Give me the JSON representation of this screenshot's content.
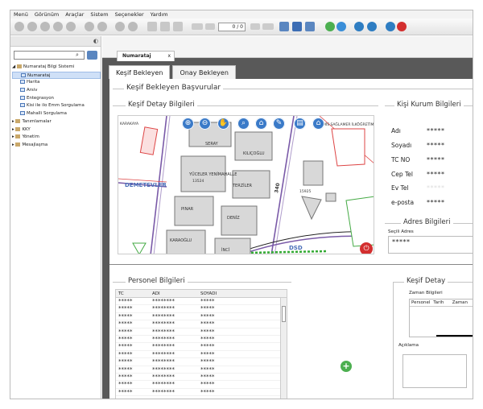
{
  "menu": [
    "Menü",
    "Görünüm",
    "Araçlar",
    "Sistem",
    "Seçenekler",
    "Yardım"
  ],
  "toolbar": {
    "page_value": "0 / 0"
  },
  "sidebar": {
    "tree": [
      {
        "label": "Numarataj Bilgi Sistemi",
        "level": 0,
        "type": "folder"
      },
      {
        "label": "Numarataj",
        "level": 1,
        "type": "page",
        "selected": true
      },
      {
        "label": "Harita",
        "level": 1,
        "type": "page"
      },
      {
        "label": "Arsiv",
        "level": 1,
        "type": "page"
      },
      {
        "label": "Entegrasyon",
        "level": 1,
        "type": "page"
      },
      {
        "label": "Kisi ile ilo Emm Sorgulama",
        "level": 1,
        "type": "page"
      },
      {
        "label": "Mahalli Sorgulama",
        "level": 1,
        "type": "page"
      },
      {
        "label": "Tanımlamalar",
        "level": 0,
        "type": "folder"
      },
      {
        "label": "KKY",
        "level": 0,
        "type": "folder"
      },
      {
        "label": "Yönetim",
        "level": 0,
        "type": "folder"
      },
      {
        "label": "Mesajlaşma",
        "level": 0,
        "type": "folder"
      }
    ]
  },
  "doc_tab": {
    "label": "Numarataj",
    "close": "x"
  },
  "tabs": [
    "Keşif Bekleyen",
    "Onay Bekleyen"
  ],
  "sections": {
    "basvurular": "Keşif Bekleyen Başvurular",
    "kesif_detay_bilgileri": "Keşif Detay Bilgileri",
    "kisi_kurum": "Kişi Kurum Bilgileri",
    "adres": "Adres Bilgileri",
    "personel": "Personel Bilgileri",
    "kesif_detay": "Keşif Detay"
  },
  "map": {
    "labels": [
      "SERAY",
      "KILIÇOĞLU",
      "YÜCELER YENİMAHALLE",
      "TERZİLER",
      "PINAR",
      "DENİZ",
      "KARAOĞLU",
      "İNCİ",
      "DEMETEVLER",
      "KARAKAYA",
      "MİS SAĞLAMER İLKÖĞRETİM",
      "DSD",
      "340",
      "15925",
      "13524"
    ]
  },
  "kisi": {
    "fields": [
      {
        "label": "Adı",
        "value": "*****"
      },
      {
        "label": "Soyadı",
        "value": "*****"
      },
      {
        "label": "TC NO",
        "value": "*****"
      },
      {
        "label": "Cep Tel",
        "value": "*****"
      },
      {
        "label": "Ev Tel",
        "value": "*****"
      },
      {
        "label": "e-posta",
        "value": "*****"
      }
    ]
  },
  "adres": {
    "label": "Seçili Adres",
    "value": "*****"
  },
  "personel": {
    "headers": [
      "TC",
      "ADI",
      "SOYADI",
      ""
    ],
    "rows": [
      [
        "*****",
        "********",
        "*****"
      ],
      [
        "*****",
        "********",
        "*****"
      ],
      [
        "*****",
        "********",
        "*****"
      ],
      [
        "*****",
        "********",
        "*****"
      ],
      [
        "*****",
        "********",
        "*****"
      ],
      [
        "*****",
        "********",
        "*****"
      ],
      [
        "*****",
        "********",
        "*****"
      ],
      [
        "*****",
        "********",
        "*****"
      ],
      [
        "*****",
        "********",
        "*****"
      ],
      [
        "*****",
        "********",
        "*****"
      ],
      [
        "*****",
        "********",
        "*****"
      ],
      [
        "*****",
        "********",
        "*****"
      ],
      [
        "*****",
        "********",
        "*****"
      ]
    ]
  },
  "kesif_detay": {
    "zaman_label": "Zaman Bilgileri",
    "zaman_headers": [
      "Personel",
      "Tarih",
      "Zaman"
    ],
    "aciklama_label": "Açıklama"
  },
  "colors": {
    "accent": "#3a7ac8",
    "add_button": "#4caf50",
    "power_button": "#d32f2f"
  }
}
